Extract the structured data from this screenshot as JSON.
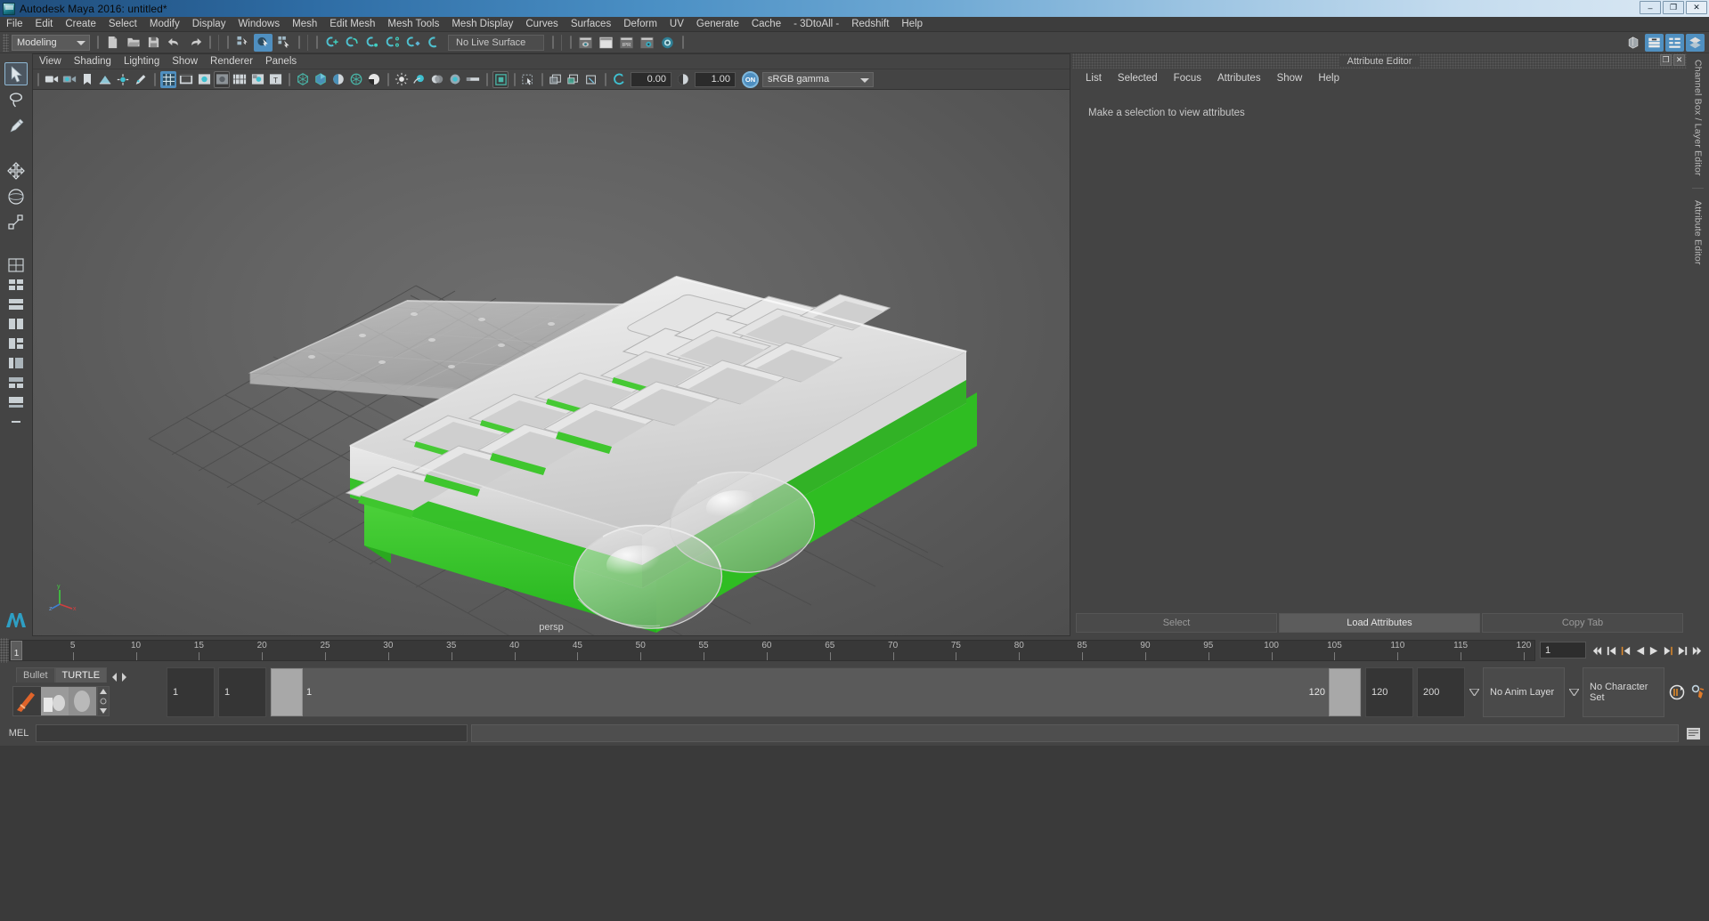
{
  "window": {
    "title": "Autodesk Maya 2016: untitled*",
    "icon": "maya-app-icon",
    "minimize": "–",
    "maximize": "❐",
    "close": "✕"
  },
  "menubar": {
    "items": [
      {
        "label": "File"
      },
      {
        "label": "Edit"
      },
      {
        "label": "Create"
      },
      {
        "label": "Select"
      },
      {
        "label": "Modify"
      },
      {
        "label": "Display"
      },
      {
        "label": "Windows"
      },
      {
        "label": "Mesh"
      },
      {
        "label": "Edit Mesh"
      },
      {
        "label": "Mesh Tools"
      },
      {
        "label": "Mesh Display"
      },
      {
        "label": "Curves"
      },
      {
        "label": "Surfaces"
      },
      {
        "label": "Deform"
      },
      {
        "label": "UV"
      },
      {
        "label": "Generate"
      },
      {
        "label": "Cache"
      },
      {
        "label": "- 3DtoAll -"
      },
      {
        "label": "Redshift"
      },
      {
        "label": "Help"
      }
    ]
  },
  "toolbar": {
    "mode_menu_value": "Modeling",
    "live_surface_label": "No Live Surface",
    "icons": [
      "new-scene-icon",
      "open-scene-icon",
      "save-scene-icon",
      "undo-icon",
      "redo-icon",
      "select-by-hierarchy-icon",
      "select-by-object-icon",
      "select-by-component-icon",
      "snap-to-grid-icon",
      "snap-to-curve-icon",
      "snap-to-point-icon",
      "snap-to-projected-center-icon",
      "snap-to-view-plane-icon",
      "make-live-icon",
      "render-current-frame-icon",
      "ipr-render-icon",
      "render-settings-icon",
      "hypershade-icon",
      "render-view-icon"
    ],
    "right_icons": [
      "modeling-toolkit-icon",
      "channel-box-icon",
      "attribute-editor-icon",
      "layer-editor-icon"
    ]
  },
  "toolbox": {
    "tools": [
      {
        "name": "select-tool",
        "selected": true
      },
      {
        "name": "lasso-select-tool",
        "selected": false
      },
      {
        "name": "paint-select-tool",
        "selected": false
      },
      {
        "name": "move-tool",
        "selected": false
      },
      {
        "name": "rotate-tool",
        "selected": false
      },
      {
        "name": "scale-tool",
        "selected": false
      }
    ],
    "layouts": [
      "single-perspective-layout",
      "four-view-layout",
      "two-panes-stacked-layout",
      "two-panes-side-layout",
      "three-panes-layout",
      "outliner-persp-layout",
      "hypershade-persp-layout",
      "persp-graph-layout",
      "more-layouts"
    ],
    "logo": "maya-logo"
  },
  "panel": {
    "menu": [
      {
        "label": "View"
      },
      {
        "label": "Shading"
      },
      {
        "label": "Lighting"
      },
      {
        "label": "Show"
      },
      {
        "label": "Renderer"
      },
      {
        "label": "Panels"
      }
    ],
    "exposure_value": "0.00",
    "gamma_value": "1.00",
    "color_management_toggle": "ON",
    "color_profile": "sRGB gamma",
    "camera_label": "persp",
    "icons": [
      "select-camera-icon",
      "camera-attributes-icon",
      "bookmark-icon",
      "image-plane-icon",
      "two-d-pan-zoom-icon",
      "grease-pencil-icon",
      "grid-toggle-icon",
      "film-gate-icon",
      "resolution-gate-icon",
      "gate-mask-icon",
      "field-chart-icon",
      "safe-action-icon",
      "safe-title-icon",
      "wireframe-shading-icon",
      "smooth-shade-all-icon",
      "smooth-shade-selected-icon",
      "flat-shade-icon",
      "shaded-and-textured-icon",
      "use-default-lighting-icon",
      "use-all-lights-icon",
      "shadows-icon",
      "screen-space-ao-icon",
      "motion-blur-icon",
      "multisample-aa-icon",
      "isolate-select-icon",
      "xray-icon",
      "xray-joints-icon",
      "xray-active-icon",
      "exposure-icon",
      "gamma-icon"
    ],
    "axis_gizmo": {
      "x": "x",
      "y": "y",
      "z": "z"
    }
  },
  "attribute_editor": {
    "panel_title": "Attribute Editor",
    "float_button": "❐",
    "close_button": "✕",
    "menu": [
      {
        "label": "List"
      },
      {
        "label": "Selected"
      },
      {
        "label": "Focus"
      },
      {
        "label": "Attributes"
      },
      {
        "label": "Show"
      },
      {
        "label": "Help"
      }
    ],
    "empty_message": "Make a selection to view attributes",
    "footer_buttons": [
      {
        "label": "Select",
        "active": false
      },
      {
        "label": "Load Attributes",
        "active": true
      },
      {
        "label": "Copy Tab",
        "active": false
      }
    ]
  },
  "right_tabs": [
    {
      "label": "Channel Box / Layer Editor"
    },
    {
      "label": "Attribute Editor"
    }
  ],
  "time_slider": {
    "current_frame_marker": "1",
    "current_frame_field": "1",
    "range_start": 1,
    "range_end": 120,
    "tick_labels": [
      5,
      10,
      15,
      20,
      25,
      30,
      35,
      40,
      45,
      50,
      55,
      60,
      65,
      70,
      75,
      80,
      85,
      90,
      95,
      100,
      105,
      110,
      115,
      120
    ],
    "playback_buttons": [
      "go-to-start-icon",
      "step-back-frame-icon",
      "step-back-key-icon",
      "play-backwards-icon",
      "play-forwards-icon",
      "step-forward-key-icon",
      "step-forward-frame-icon",
      "go-to-end-icon"
    ]
  },
  "range_slider": {
    "anim_start": "1",
    "anim_end": "1",
    "range_start_label": "1",
    "range_end_label": "120",
    "playback_end": "120",
    "anim_total_end": "200",
    "anim_layer": "No Anim Layer",
    "character_set": "No Character Set",
    "auto_key_icon": "auto-keyframe-icon",
    "prefs_icon": "animation-preferences-icon"
  },
  "mini_shelf": {
    "tabs": [
      {
        "label": "Bullet",
        "active": false
      },
      {
        "label": "TURTLE",
        "active": true
      }
    ],
    "prev_arrow": "◀",
    "next_arrow": "▶",
    "icons": [
      "turtle-render-icon",
      "turtle-bake-icon",
      "turtle-sphere-icon"
    ]
  },
  "command_line": {
    "label": "MEL",
    "input_value": "",
    "output_value": "",
    "script_editor_icon": "script-editor-icon"
  },
  "colors": {
    "accent_blue": "#4f8fc0",
    "panel_bg": "#444444",
    "viewport_bg": "#5d5d5d",
    "teal_icon": "#2fa9b8",
    "orange_marker": "#e07b2a",
    "tray_green": "#35c22b"
  }
}
